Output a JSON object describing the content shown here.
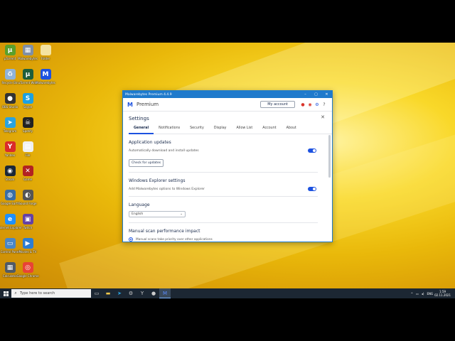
{
  "desktop_icons": [
    {
      "label": "µTorrent",
      "color": "#5aa02c",
      "glyph": "µ",
      "col": 0,
      "row": 0
    },
    {
      "label": "Malwarebytes",
      "color": "#7f8fa6",
      "glyph": "▦",
      "col": 1,
      "row": 0
    },
    {
      "label": "Folder",
      "color": "#f4e3a1",
      "glyph": "",
      "col": 2,
      "row": 0
    },
    {
      "label": "Recycle Bin",
      "color": "#8fb3d9",
      "glyph": "♻",
      "col": 0,
      "row": 1
    },
    {
      "label": "uTorrent Web",
      "color": "#1f5e3c",
      "glyph": "µ",
      "col": 1,
      "row": 1
    },
    {
      "label": "Malwarebytes",
      "color": "#1d52e0",
      "glyph": "M",
      "col": 2,
      "row": 1
    },
    {
      "label": "OBS Studio",
      "color": "#333333",
      "glyph": "●",
      "col": 0,
      "row": 2
    },
    {
      "label": "Skype",
      "color": "#1ba1e2",
      "glyph": "S",
      "col": 1,
      "row": 2
    },
    {
      "label": "Telegram",
      "color": "#2aa3df",
      "glyph": "➤",
      "col": 0,
      "row": 3
    },
    {
      "label": "Spotify",
      "color": "#222222",
      "glyph": "☠",
      "col": 1,
      "row": 3
    },
    {
      "label": "Yandex",
      "color": "#d92b2b",
      "glyph": "Y",
      "col": 0,
      "row": 4
    },
    {
      "label": "File",
      "color": "#f0f0f0",
      "glyph": "▤",
      "col": 1,
      "row": 4
    },
    {
      "label": "Steam",
      "color": "#1b2838",
      "glyph": "◉",
      "col": 0,
      "row": 5
    },
    {
      "label": "Game",
      "color": "#b22222",
      "glyph": "✕",
      "col": 1,
      "row": 5
    },
    {
      "label": "Google Earth",
      "color": "#3a6ea5",
      "glyph": "◍",
      "col": 0,
      "row": 6
    },
    {
      "label": "Sound Forge",
      "color": "#555555",
      "glyph": "◐",
      "col": 1,
      "row": 6
    },
    {
      "label": "Internet Explorer",
      "color": "#1e90ff",
      "glyph": "e",
      "col": 0,
      "row": 7
    },
    {
      "label": "Twitch",
      "color": "#6441a5",
      "glyph": "▣",
      "col": 1,
      "row": 7
    },
    {
      "label": "Control Panel",
      "color": "#4a86c5",
      "glyph": "▭",
      "col": 0,
      "row": 8
    },
    {
      "label": "Movies & TV",
      "color": "#2d7dd2",
      "glyph": "▶",
      "col": 1,
      "row": 8
    },
    {
      "label": "Calculator",
      "color": "#505a66",
      "glyph": "▦",
      "col": 0,
      "row": 9
    },
    {
      "label": "Google Chrome",
      "color": "#e84335",
      "glyph": "◎",
      "col": 1,
      "row": 9
    }
  ],
  "taskbar": {
    "search_placeholder": "Type here to search",
    "tray_lang": "ENG",
    "time": "1:59",
    "date": "02.11.2021"
  },
  "window": {
    "title": "Malwarebytes Premium  4.4.9",
    "edition": "Premium",
    "my_account": "My account",
    "settings_title": "Settings",
    "tabs": [
      "General",
      "Notifications",
      "Security",
      "Display",
      "Allow List",
      "Account",
      "About"
    ],
    "active_tab": "General",
    "app_updates_title": "Application updates",
    "app_updates_desc": "Automatically download and install updates",
    "check_updates_btn": "Check for updates",
    "explorer_title": "Windows Explorer settings",
    "explorer_desc": "Add Malwarebytes options to Windows Explorer",
    "language_title": "Language",
    "language_value": "English",
    "scan_title": "Manual scan performance impact",
    "scan_option": "Manual scans take priority over other applications"
  }
}
